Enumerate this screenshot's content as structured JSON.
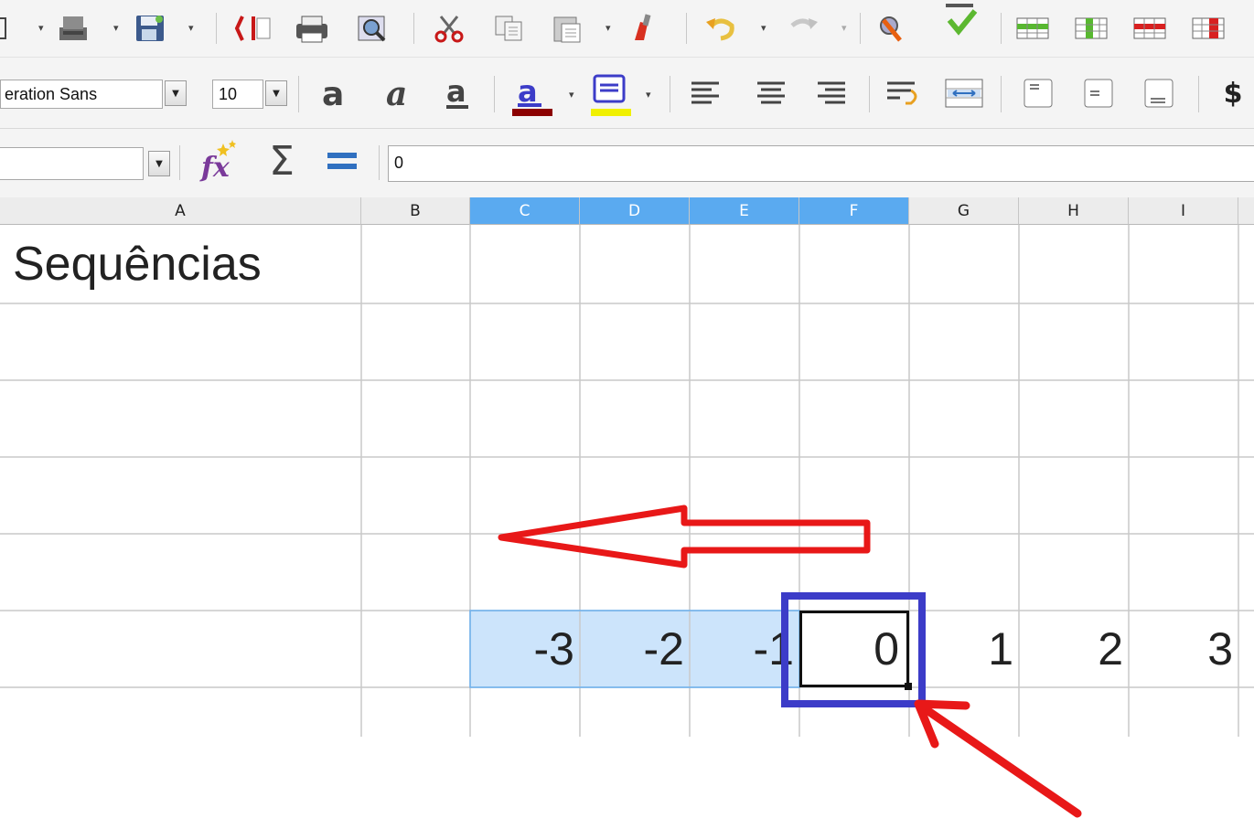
{
  "app": {
    "font_name": "eration Sans",
    "font_size": "10",
    "cell_ref": "",
    "formula": "0"
  },
  "icons": [
    "new-document-icon",
    "open-icon",
    "save-icon",
    "export-pdf-icon",
    "print-icon",
    "print-preview-icon",
    "cut-icon",
    "copy-icon",
    "paste-icon",
    "clone-formatting-icon",
    "undo-icon",
    "redo-icon",
    "spelling-icon",
    "autospell-icon",
    "insert-rows-icon",
    "insert-columns-icon",
    "delete-rows-icon",
    "delete-columns-icon",
    "bold-icon",
    "italic-icon",
    "underline-icon",
    "font-color-icon",
    "background-color-icon",
    "align-left-icon",
    "align-center-icon",
    "align-right-icon",
    "wrap-text-icon",
    "merge-cells-icon",
    "align-top-icon",
    "align-middle-icon",
    "align-bottom-icon",
    "currency-icon",
    "function-wizard-icon",
    "sum-icon",
    "formula-icon"
  ],
  "toolbar": {
    "currency_label": "$"
  },
  "formula_bar": {
    "sum_label": "Σ",
    "equals_label": "="
  },
  "columns": [
    "A",
    "B",
    "C",
    "D",
    "E",
    "F",
    "G",
    "H",
    "I"
  ],
  "selected_columns": [
    "C",
    "D",
    "E",
    "F"
  ],
  "cells": {
    "a1": "Sequências",
    "row6": [
      "-3",
      "-2",
      "-1",
      "0",
      "1",
      "2",
      "3"
    ]
  },
  "colors": {
    "selection": "#cce4fb",
    "header_selected": "#5aaaf0",
    "annotation_blue": "#3c3cc8",
    "annotation_red": "#e81818"
  }
}
